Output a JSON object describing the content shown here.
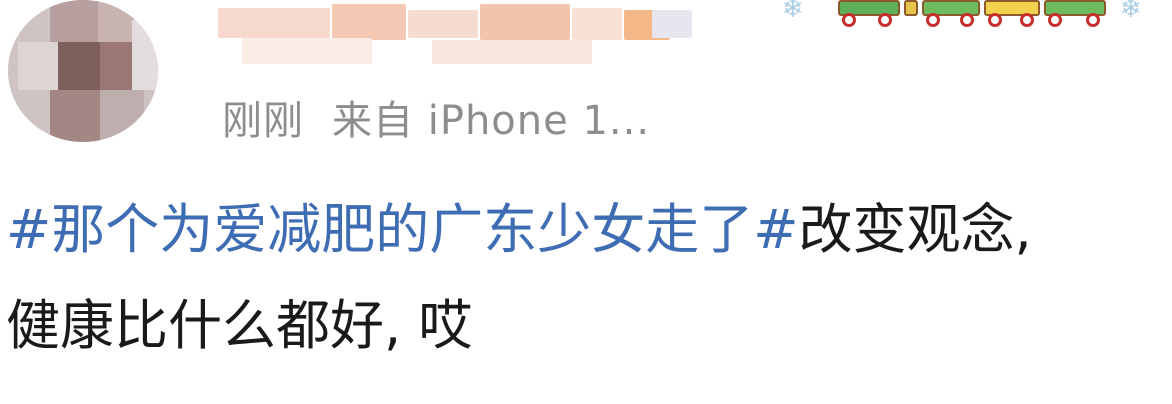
{
  "post": {
    "meta_time": "刚刚",
    "meta_source": "来自 iPhone 1...",
    "topic": "#那个为爱减肥的广东少女走了#",
    "text_line1": "改变观念,",
    "text_line2": "健康比什么都好,  哎"
  },
  "colors": {
    "topic": "#3f6db4",
    "text": "#1a1a1a",
    "meta": "#8d8d8d"
  }
}
